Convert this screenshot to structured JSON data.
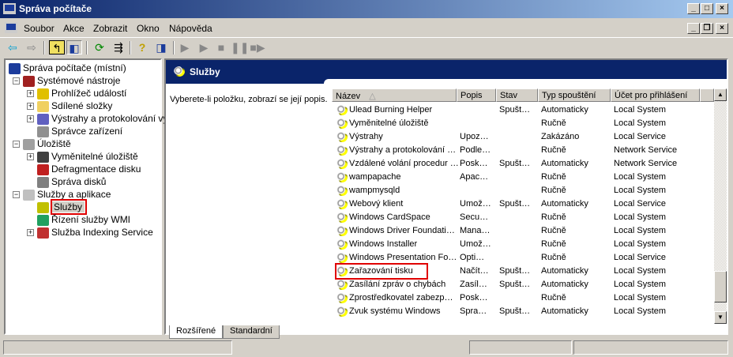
{
  "window": {
    "title": "Správa počítače"
  },
  "menu": [
    "Soubor",
    "Akce",
    "Zobrazit",
    "Okno",
    "Nápověda"
  ],
  "toolbar_icons": [
    "back-arrow-icon",
    "forward-arrow-icon",
    "up-folder-icon",
    "show-hide-tree-icon",
    "refresh-icon",
    "export-list-icon",
    "help-icon",
    "action-pane-icon",
    "start-service-icon",
    "start-service-alt-icon",
    "stop-service-icon",
    "pause-service-icon",
    "restart-service-icon"
  ],
  "tree": [
    {
      "label": "Správa počítače (místní)",
      "level": 0,
      "color": "#1c3c9c"
    },
    {
      "label": "Systémové nástroje",
      "level": 1,
      "color": "#a02020",
      "pm": "−"
    },
    {
      "label": "Prohlížeč událostí",
      "level": 2,
      "color": "#e0c000",
      "pm": "+"
    },
    {
      "label": "Sdílené složky",
      "level": 2,
      "color": "#f0d060",
      "pm": "+"
    },
    {
      "label": "Výstrahy a protokolování vý",
      "level": 2,
      "color": "#6060c0",
      "pm": "+"
    },
    {
      "label": "Správce zařízení",
      "level": 2,
      "color": "#909090"
    },
    {
      "label": "Úložiště",
      "level": 1,
      "color": "#a0a0a0",
      "pm": "−"
    },
    {
      "label": "Vyměnitelné úložiště",
      "level": 2,
      "color": "#404040",
      "pm": "+"
    },
    {
      "label": "Defragmentace disku",
      "level": 2,
      "color": "#c02020"
    },
    {
      "label": "Správa disků",
      "level": 2,
      "color": "#808080"
    },
    {
      "label": "Služby a aplikace",
      "level": 1,
      "color": "#c0c0c0",
      "pm": "−"
    },
    {
      "label": "Služby",
      "level": 2,
      "color": "#c0c000",
      "selected": true
    },
    {
      "label": "Řízení služby WMI",
      "level": 2,
      "color": "#20a060"
    },
    {
      "label": "Služba Indexing Service",
      "level": 2,
      "color": "#c03030",
      "pm": "+"
    }
  ],
  "pane": {
    "title": "Služby",
    "description": "Vyberete-li položku, zobrazí se její popis."
  },
  "columns": [
    "Název",
    "Popis",
    "Stav",
    "Typ spouštění",
    "Účet pro přihlášení"
  ],
  "rows": [
    [
      "Ulead Burning Helper",
      "",
      "Spušt…",
      "Automaticky",
      "Local System"
    ],
    [
      "Vyměnitelné úložiště",
      "",
      "",
      "Ručně",
      "Local System"
    ],
    [
      "Výstrahy",
      "Upoz…",
      "",
      "Zakázáno",
      "Local Service"
    ],
    [
      "Výstrahy a protokolování …",
      "Podle…",
      "",
      "Ručně",
      "Network Service"
    ],
    [
      "Vzdálené volání procedur …",
      "Posk…",
      "Spušt…",
      "Automaticky",
      "Network Service"
    ],
    [
      "wampapache",
      "Apac…",
      "",
      "Ručně",
      "Local System"
    ],
    [
      "wampmysqld",
      "",
      "",
      "Ručně",
      "Local System"
    ],
    [
      "Webový klient",
      "Umož…",
      "Spušt…",
      "Automaticky",
      "Local Service"
    ],
    [
      "Windows CardSpace",
      "Secu…",
      "",
      "Ručně",
      "Local System"
    ],
    [
      "Windows Driver Foundati…",
      "Mana…",
      "",
      "Ručně",
      "Local System"
    ],
    [
      "Windows Installer",
      "Umož…",
      "",
      "Ručně",
      "Local System"
    ],
    [
      "Windows Presentation Fo…",
      "Opti…",
      "",
      "Ručně",
      "Local Service"
    ],
    [
      "Zařazování tisku",
      "Načít…",
      "Spušt…",
      "Automaticky",
      "Local System"
    ],
    [
      "Zasílání zpráv o chybách",
      "Zasíl…",
      "Spušt…",
      "Automaticky",
      "Local System"
    ],
    [
      "Zprostředkovatel zabezp…",
      "Posk…",
      "",
      "Ručně",
      "Local System"
    ],
    [
      "Zvuk systému Windows",
      "Spra…",
      "Spušt…",
      "Automaticky",
      "Local System"
    ]
  ],
  "tabs": [
    "Rozšířené",
    "Standardní"
  ],
  "scroll_position": 0.95
}
